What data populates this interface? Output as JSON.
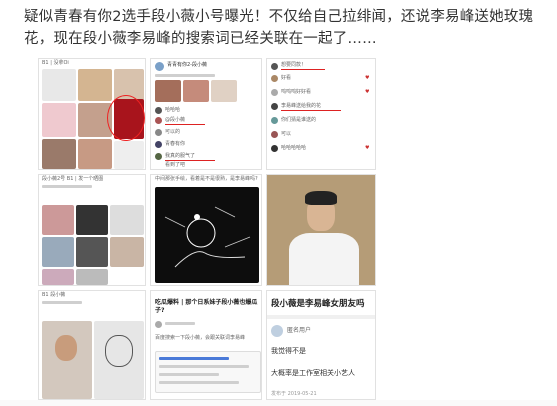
{
  "headline": "疑似青春有你2选手段小薇小号曝光！不仅给自己拉绯闻，还说李易峰送她玫瑰花，现在段小薇李易峰的搜索词已经关联在一起了……",
  "tiles": {
    "t1": {
      "caption": "B1 | 没拿Oi"
    },
    "t2": {
      "account": "青青有你2-段小薇",
      "comments": [
        "哈哈哈",
        "@段小薇",
        "可以的",
        "青春有你",
        "我真的服气了",
        "看到了吧"
      ]
    },
    "t3": {
      "comments": [
        "想要同款！",
        "好看",
        "呜呜呜好好看",
        "李易峰送给我的花",
        "你们猜是谁送的",
        "可以",
        "哈哈哈哈哈"
      ]
    },
    "t4": {
      "caption": "段小薇2号 B1 | 发一个晒图"
    },
    "t5": {
      "caption": "中间那张手绘，看着是不是很熟，是李易峰吗?"
    },
    "t6": {
      "caption": ""
    },
    "t7": {
      "caption": "B1 段小薇"
    },
    "t8": {
      "title": "吃瓜爆料 | 那个日系妹子段小薇也爆瓜子?",
      "sub": "百度搜索一下段小薇，会跟关联词李易峰"
    },
    "t9": {
      "title": "段小薇是李易峰女朋友吗",
      "user": "匿名用户",
      "answer": "我觉得不是",
      "detail": "大概率是工作室相关小艺人",
      "footer": "发布于 2019-05-21"
    }
  },
  "colors": {
    "accent_red": "#dd2222",
    "headline": "#333333",
    "tile_border": "#e1e1e1"
  }
}
